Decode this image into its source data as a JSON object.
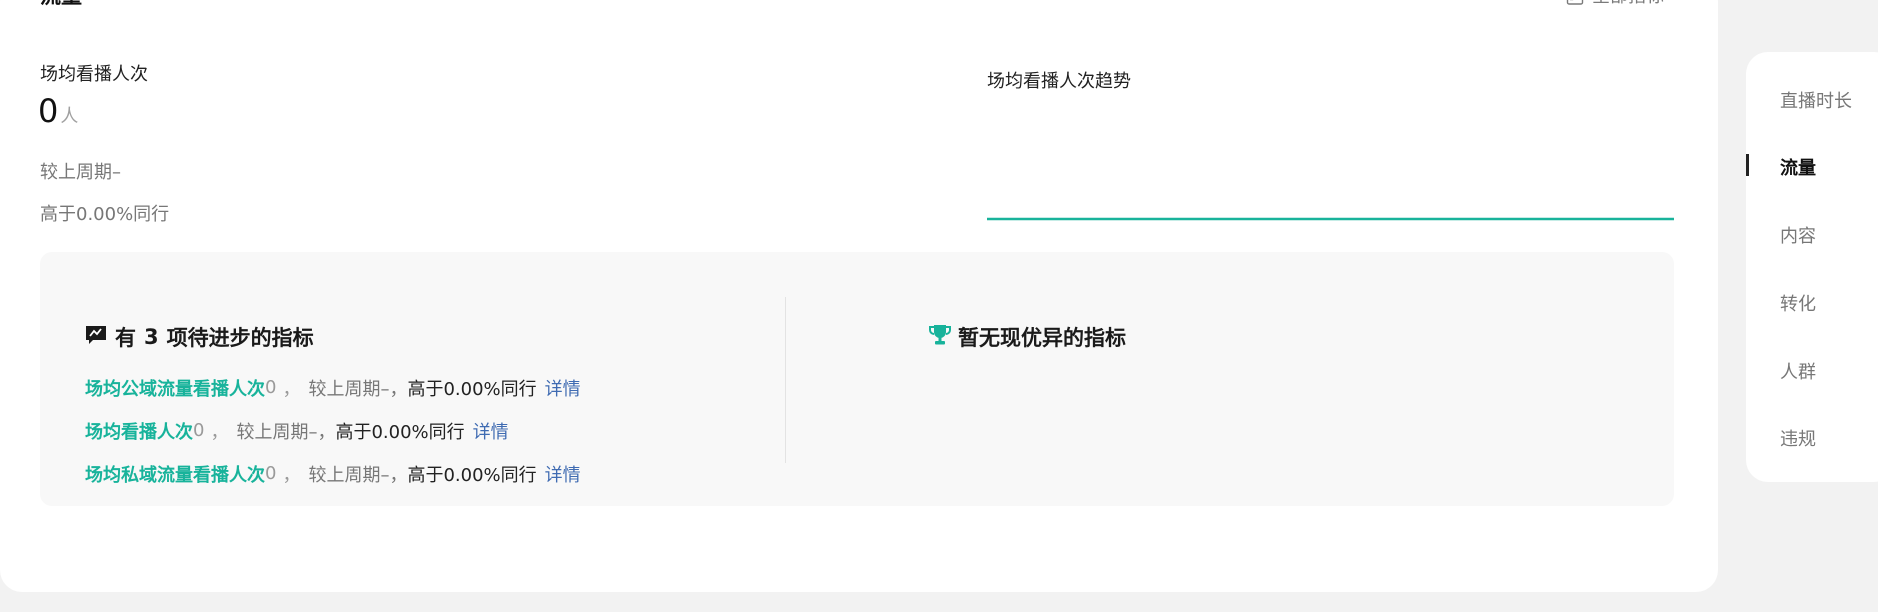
{
  "section": {
    "title": "流量",
    "all_metrics_label": "全部指标"
  },
  "metric": {
    "label": "场均看播人次",
    "value": "0",
    "unit": "人",
    "compare": "较上周期–",
    "peer": "高于0.00%同行"
  },
  "trend": {
    "title": "场均看播人次趋势",
    "line_color": "#18b39b"
  },
  "improve": {
    "heading_prefix": "有",
    "count": "3",
    "heading_suffix": "项待进步的指标",
    "items": [
      {
        "name": "场均公域流量看播人次",
        "value": "0",
        "sep": "，",
        "compare": "较上周期–，",
        "peer": "高于0.00%同行",
        "detail": "详情"
      },
      {
        "name": "场均看播人次",
        "value": "0",
        "sep": "，",
        "compare": "较上周期–，",
        "peer": "高于0.00%同行",
        "detail": "详情"
      },
      {
        "name": "场均私域流量看播人次",
        "value": "0",
        "sep": "，",
        "compare": "较上周期–，",
        "peer": "高于0.00%同行",
        "detail": "详情"
      }
    ]
  },
  "excellent": {
    "heading": "暂无现优异的指标"
  },
  "sidenav": {
    "items": [
      {
        "label": "直播时长",
        "active": false
      },
      {
        "label": "流量",
        "active": true
      },
      {
        "label": "内容",
        "active": false
      },
      {
        "label": "转化",
        "active": false
      },
      {
        "label": "人群",
        "active": false
      },
      {
        "label": "违规",
        "active": false
      }
    ]
  },
  "icons": {
    "all_metrics": "clipboard-list-icon",
    "improve": "flag-icon",
    "excellent": "trophy-icon"
  },
  "colors": {
    "accent": "#18b39b",
    "link": "#3f6bb2"
  }
}
